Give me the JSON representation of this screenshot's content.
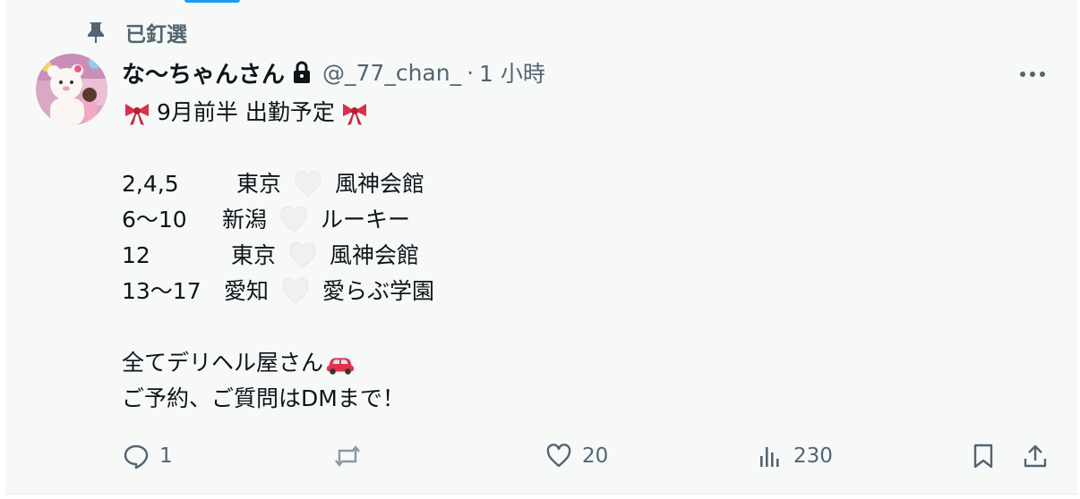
{
  "pinned": {
    "label": "已釘選"
  },
  "tweet": {
    "display_name": "な〜ちゃんさん",
    "handle": "@_77_chan_",
    "separator": "·",
    "time": "1 小時",
    "intro": "9月前半 出勤予定",
    "schedule": [
      {
        "dates": "2,4,5",
        "city": "東京",
        "venue": "風神会館"
      },
      {
        "dates": "6〜10",
        "city": "新潟",
        "venue": "ルーキー"
      },
      {
        "dates": "12",
        "city": "東京",
        "venue": "風神会館"
      },
      {
        "dates": "13〜17",
        "city": "愛知",
        "venue": "愛らぶ学園"
      }
    ],
    "outro_line1": "全てデリヘル屋さん",
    "outro_line2": "ご予約、ご質問はDMまで！"
  },
  "actions": {
    "reply_count": "1",
    "retweet_count": "",
    "like_count": "20",
    "view_count": "230"
  },
  "icons": {
    "pin": "pin-icon",
    "lock": "lock-icon",
    "more": "more-icon",
    "ribbon": "ribbon-emoji",
    "heart": "white-heart-emoji",
    "car": "car-emoji",
    "reply": "reply-icon",
    "retweet": "retweet-icon",
    "like": "heart-icon",
    "views": "views-icon",
    "bookmark": "bookmark-icon",
    "share": "share-icon"
  },
  "colors": {
    "card_background": "#f7f9f9",
    "secondary_text": "#536471",
    "primary_text": "#0f1419",
    "accent": "#1d9bf0",
    "ribbon_red": "#d9304a",
    "car_red": "#e0334a"
  }
}
